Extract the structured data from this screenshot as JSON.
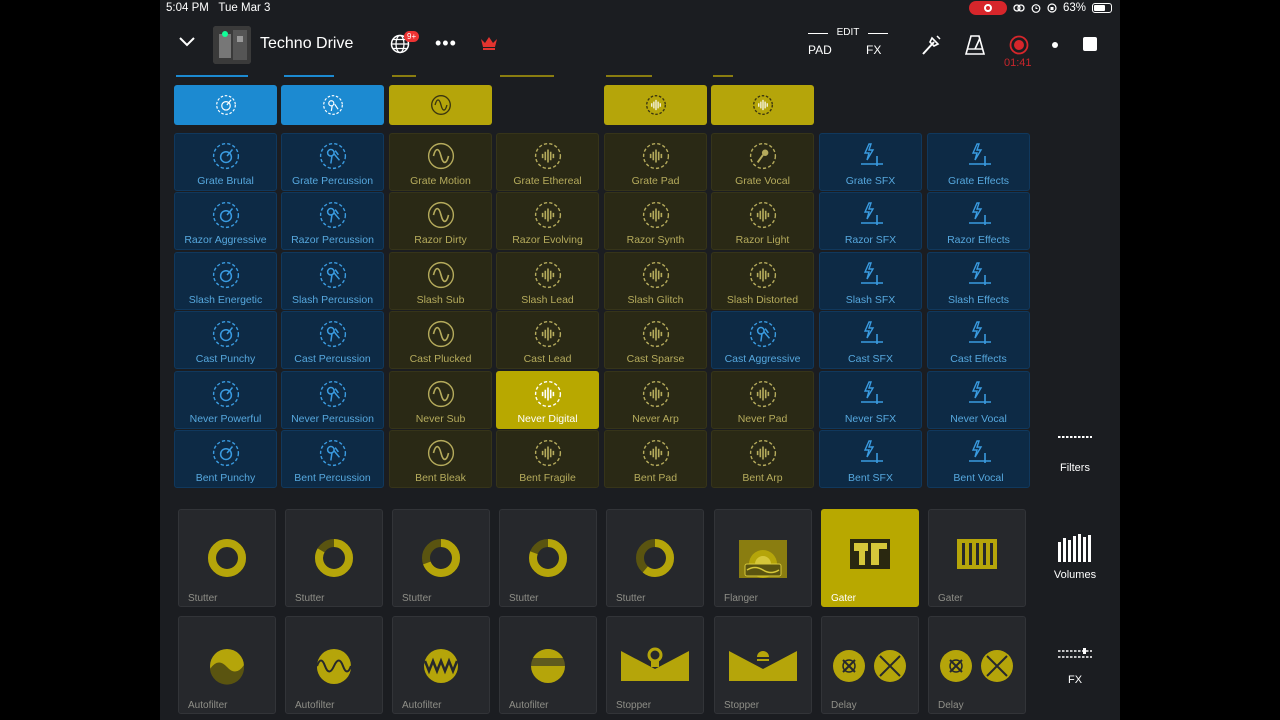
{
  "status_bar": {
    "time": "5:04 PM",
    "date": "Tue Mar 3",
    "battery": "63%"
  },
  "header": {
    "project_title": "Techno Drive",
    "notification_badge": "9+",
    "edit_label": "EDIT",
    "pad_label": "PAD",
    "fx_label": "FX",
    "record_time": "01:41",
    "icons": [
      "chevron-down-icon",
      "globe-icon",
      "more-icon",
      "crown-icon",
      "mic-stand-icon",
      "metronome-icon",
      "record-icon",
      "dot-icon",
      "stop-icon"
    ]
  },
  "colors": {
    "blue_pad": "#0d2a45",
    "blue_accent": "#1c8ad1",
    "olive_pad": "#2a2915",
    "olive_accent": "#b8a800",
    "record_red": "#d7262b"
  },
  "pads": {
    "columns": [
      {
        "color": "blue",
        "icon": "drum-icon",
        "labels": [
          "Grate Brutal",
          "Razor Aggressive",
          "Slash Energetic",
          "Cast Punchy",
          "Never Powerful",
          "Bent Punchy"
        ]
      },
      {
        "color": "blue",
        "icon": "percussion-icon",
        "labels": [
          "Grate Percussion",
          "Razor Percussion",
          "Slash Percussion",
          "Cast Percussion",
          "Never Percussion",
          "Bent Percussion"
        ]
      },
      {
        "color": "olive",
        "icon": "sine-wave-icon",
        "labels": [
          "Grate Motion",
          "Razor Dirty",
          "Slash Sub",
          "Cast Plucked",
          "Never Sub",
          "Bent Bleak"
        ]
      },
      {
        "color": "olive",
        "icon": "waveform-icon",
        "labels": [
          "Grate Ethereal",
          "Razor Evolving",
          "Slash Lead",
          "Cast Lead",
          "Never Digital",
          "Bent Fragile"
        ]
      },
      {
        "color": "olive",
        "icon": "waveform-icon",
        "labels": [
          "Grate Pad",
          "Razor Synth",
          "Slash Glitch",
          "Cast Sparse",
          "Never Arp",
          "Bent Pad"
        ]
      },
      {
        "color": "olive",
        "icon": "waveform-icon",
        "labels": [
          "Grate Vocal",
          "Razor Light",
          "Slash Distorted",
          "Cast Aggressive",
          "Never Pad",
          "Bent Arp"
        ]
      },
      {
        "color": "blue",
        "icon": "sfx-icon",
        "labels": [
          "Grate SFX",
          "Razor SFX",
          "Slash SFX",
          "Cast SFX",
          "Never SFX",
          "Bent SFX"
        ]
      },
      {
        "color": "blue",
        "icon": "sfx-icon",
        "labels": [
          "Grate Effects",
          "Razor Effects",
          "Slash Effects",
          "Cast Effects",
          "Never Vocal",
          "Bent Vocal"
        ]
      }
    ],
    "selected": "Never Digital"
  },
  "fx_row1": [
    "Stutter",
    "Stutter",
    "Stutter",
    "Stutter",
    "Stutter",
    "Flanger",
    "Gater",
    "Gater"
  ],
  "fx_row2": [
    "Autofilter",
    "Autofilter",
    "Autofilter",
    "Autofilter",
    "Stopper",
    "Stopper",
    "Delay",
    "Delay"
  ],
  "active_fx": "Gater",
  "side_panel": {
    "filters": "Filters",
    "volumes": "Volumes",
    "fx": "FX"
  }
}
